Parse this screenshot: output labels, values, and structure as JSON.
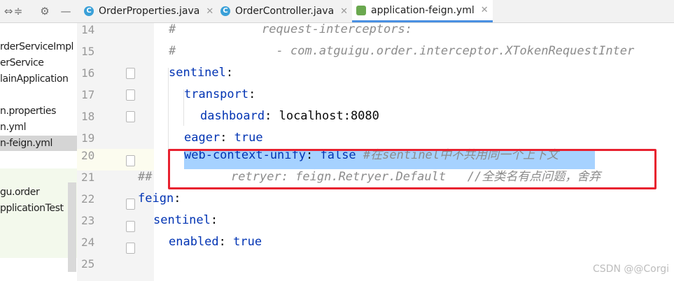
{
  "toolbar": {
    "icons": [
      "split-icon",
      "collapse-icon",
      "gear-icon",
      "minimize-icon"
    ]
  },
  "tabs": [
    {
      "label": "OrderProperties.java",
      "icon": "C",
      "active": false
    },
    {
      "label": "OrderController.java",
      "icon": "C",
      "active": false
    },
    {
      "label": "application-feign.yml",
      "icon": "yml",
      "active": true
    }
  ],
  "tree": {
    "items": [
      {
        "label": "rderServiceImpl",
        "selected": false
      },
      {
        "label": "erService",
        "selected": false
      },
      {
        "label": "lainApplication",
        "selected": false
      },
      {
        "label": "n.properties",
        "selected": false
      },
      {
        "label": "n.yml",
        "selected": false
      },
      {
        "label": "n-feign.yml",
        "selected": true
      },
      {
        "label": "gu.order",
        "selected": false
      },
      {
        "label": "pplicationTest",
        "selected": false
      }
    ]
  },
  "editor": {
    "line_numbers": [
      "14",
      "15",
      "16",
      "17",
      "18",
      "19",
      "20",
      "21",
      "22",
      "23",
      "24",
      "25"
    ],
    "lines": [
      {
        "segments": [
          {
            "t": "#            request-interceptors:",
            "c": "cmt"
          }
        ]
      },
      {
        "segments": [
          {
            "t": "#              - com.atguigu.order.interceptor.XTokenRequestInter",
            "c": "cmt"
          }
        ]
      },
      {
        "segments": [
          {
            "t": "sentinel",
            "c": "key"
          },
          {
            "t": ":",
            "c": "plain"
          }
        ]
      },
      {
        "segments": [
          {
            "t": "transport",
            "c": "key"
          },
          {
            "t": ":",
            "c": "plain"
          }
        ]
      },
      {
        "segments": [
          {
            "t": "dashboard",
            "c": "key"
          },
          {
            "t": ": localhost:8080",
            "c": "plain"
          }
        ]
      },
      {
        "segments": [
          {
            "t": "eager",
            "c": "key"
          },
          {
            "t": ": ",
            "c": "plain"
          },
          {
            "t": "true",
            "c": "bool"
          }
        ]
      },
      {
        "segments": [
          {
            "t": "web-context-unify",
            "c": "key"
          },
          {
            "t": ": ",
            "c": "plain"
          },
          {
            "t": "false",
            "c": "bool"
          },
          {
            "t": " #在sentinel中不共用同一个上下文",
            "c": "cmt"
          }
        ]
      },
      {
        "segments": [
          {
            "t": "##           retryer: feign.Retryer.Default   //全类名有点问题，舍弃",
            "c": "cmt"
          }
        ]
      },
      {
        "segments": [
          {
            "t": "feign",
            "c": "key"
          },
          {
            "t": ":",
            "c": "plain"
          }
        ]
      },
      {
        "segments": [
          {
            "t": "sentinel",
            "c": "key"
          },
          {
            "t": ":",
            "c": "plain"
          }
        ]
      },
      {
        "segments": [
          {
            "t": "enabled",
            "c": "key"
          },
          {
            "t": ": ",
            "c": "plain"
          },
          {
            "t": "true",
            "c": "bool"
          }
        ]
      },
      {
        "segments": []
      }
    ]
  },
  "watermark": "CSDN @@Corgi",
  "colors": {
    "selection": "#a6d2ff",
    "highlight_box": "#e8212f",
    "active_tab_underline": "#4a90e2"
  }
}
